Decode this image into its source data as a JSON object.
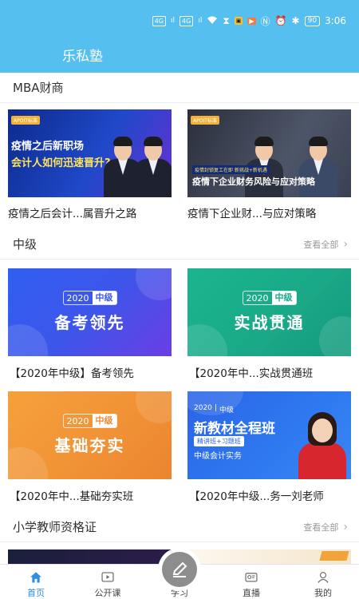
{
  "status_bar": {
    "network_1": "4G",
    "signal_1": "ıl",
    "network_2": "4G",
    "signal_2": "ıl",
    "badge_1": "▣",
    "badge_2": "▶",
    "battery": "90",
    "time": "3:06"
  },
  "app": {
    "title": "乐私塾"
  },
  "sections": {
    "mba": {
      "title": "MBA财商",
      "cards": [
        {
          "label": "疫情之后会计...属晋升之路",
          "tag": "APOIT标准",
          "line1": "疫情之后新职场",
          "line2": "会计人如何迅速晋升?"
        },
        {
          "label": "疫情下企业财...与应对策略",
          "tag": "APOIT标准",
          "strip": "疫情封锁复工在即 新挑战+新机遇",
          "line": "疫情下企业财务风险与应对策略"
        }
      ]
    },
    "zhongji": {
      "title": "中级",
      "see_all": "查看全部",
      "cards": [
        {
          "label": "【2020年中级】备考领先",
          "year": "2020",
          "level": "中级",
          "slogan": "备考领先"
        },
        {
          "label": "【2020年中...实战贯通班",
          "year": "2020",
          "level": "中级",
          "slogan": "实战贯通"
        },
        {
          "label": "【2020年中...基础夯实班",
          "year": "2020",
          "level": "中级",
          "slogan": "基础夯实"
        },
        {
          "label": "【2020年中级...务一刘老师",
          "year": "2020",
          "level": "中级",
          "title": "新教材全程班",
          "chip": "精讲班+习题班",
          "subtitle": "中级会计实务"
        }
      ]
    },
    "teacher": {
      "title": "小学教师资格证",
      "see_all": "查看全部"
    }
  },
  "tabbar": {
    "tabs": [
      {
        "label": "首页",
        "icon": "home-icon",
        "active": true
      },
      {
        "label": "公开课",
        "icon": "video-icon",
        "active": false
      },
      {
        "label": "学习",
        "icon": "pencil-icon",
        "active": false
      },
      {
        "label": "直播",
        "icon": "live-icon",
        "active": false
      },
      {
        "label": "我的",
        "icon": "user-icon",
        "active": false
      }
    ]
  },
  "colors": {
    "header": "#55bff0",
    "active_tab": "#2e8fe0"
  }
}
